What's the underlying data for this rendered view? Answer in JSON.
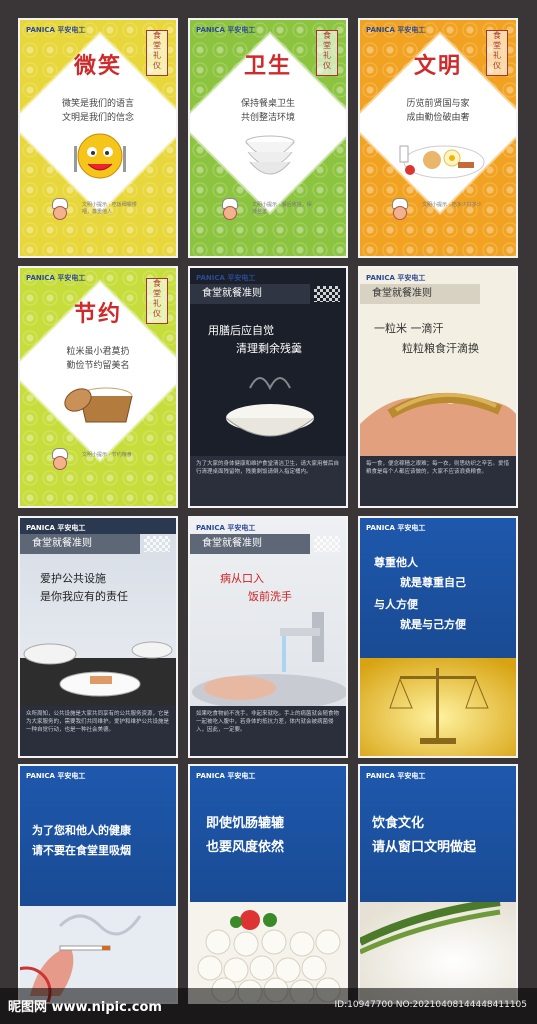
{
  "brand": "PANICA 平安电工",
  "watermark": {
    "left": "昵图网 www.nipic.com",
    "right": "ID:10947700 NO:20210408144448411105"
  },
  "posters": {
    "smile": {
      "title": "微笑",
      "line1": "微笑是我们的语言",
      "line2": "文明是我们的信念",
      "seal": "食堂礼仪",
      "tiny": "文明小提示 · 吃饭细嚼慢咽，尊重他人"
    },
    "hygiene": {
      "title": "卫生",
      "line1": "保持餐桌卫生",
      "line2": "共创整洁环境",
      "seal": "食堂礼仪",
      "tiny": "文明小提示 · 餐后收拾，保持整洁"
    },
    "civil": {
      "title": "文明",
      "line1": "历览前贤国与家",
      "line2": "成由勤俭破由奢",
      "seal": "食堂礼仪",
      "tiny": "文明小提示 · 吃多少打多少"
    },
    "thrift": {
      "title": "节约",
      "line1": "粒米虽小君莫扔",
      "line2": "勤俭节约留美名",
      "seal": "食堂礼仪",
      "tiny": "文明小提示 · 节约粮食"
    },
    "rules1": {
      "bar": "食堂就餐准则",
      "line1": "用膳后应自觉",
      "line2": "清理剩余残羹",
      "caption": "为了大家的身体健康和维护食堂清洁卫生，请大家用餐后自行清理桌面残留物，残羹剩饭请倒入指定桶内。"
    },
    "rules2": {
      "bar": "食堂就餐准则",
      "line1": "一粒米   一滴汗",
      "line2": "粒粒粮食汗滴换",
      "caption": "每一食，便念稼穑之艰难；每一衣，则思纺织之辛苦。爱惜粮食是每个人都应该做的，大家不应该浪费粮食。"
    },
    "rules3": {
      "bar": "食堂就餐准则",
      "line1": "爱护公共设施",
      "line2": "是你我应有的责任",
      "caption": "众所周知，公共设施是大家共同享有的公共服务资源，它是为大家服务的，需要我们共同维护。爱护和维护公共设施是一种自觉行动，也是一种社会美德。"
    },
    "rules4": {
      "bar": "食堂就餐准则",
      "line1": "病从口入",
      "line2": "饭前洗手",
      "caption": "如果吃食物前不洗手，非起来就吃。手上的病菌就会随食物一起被吃入腹中，若身体的抵抗力差，体内就会被病菌侵入，因此，一定要。"
    },
    "respect": {
      "line1": "尊重他人",
      "line2": "就是尊重自己",
      "line3": "与人方便",
      "line4": "就是与己方便"
    },
    "smoke": {
      "line1": "为了您和他人的健康",
      "line2": "请不要在食堂里吸烟"
    },
    "manner": {
      "line1": "即使饥肠辘辘",
      "line2": "也要风度依然"
    },
    "culture": {
      "line1": "饮食文化",
      "line2": "请从窗口文明做起"
    }
  },
  "colors": {
    "red_title": "#cf2a2a",
    "brand_blue": "#2c4a93",
    "poster_blue": "#1d4f9c"
  }
}
